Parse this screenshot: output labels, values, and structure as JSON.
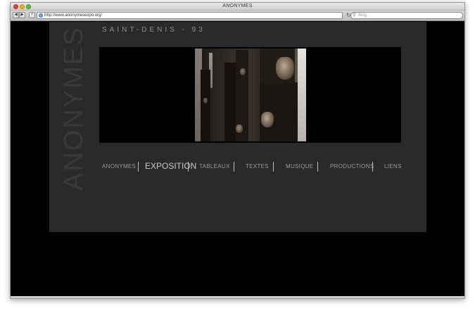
{
  "window": {
    "title": "ANONYMES"
  },
  "toolbar": {
    "url": "http://www.anonymesexpo.org/",
    "search_placeholder": "Bing",
    "back_glyph": "◀",
    "forward_glyph": "▶",
    "add_glyph": "+",
    "reload_glyph": "↻"
  },
  "site": {
    "vertical_title": "ANONYMES",
    "location": "SAINT-DENIS - 93",
    "menu": [
      {
        "label": "ANONYMES"
      },
      {
        "label": "EXPOSITION",
        "active": true
      },
      {
        "label": "TABLEAUX"
      },
      {
        "label": "TEXTES"
      },
      {
        "label": "MUSIQUE"
      },
      {
        "label": "PRODUCTIONS"
      },
      {
        "label": "LIENS"
      }
    ]
  },
  "icons": {
    "globe": "globe-icon",
    "search": "search-icon",
    "reload": "reload-icon"
  },
  "colors": {
    "page_bg": "#000000",
    "panel_bg": "#2a2a2a",
    "menu_text": "#9a9a9a",
    "menu_active": "#c8c8c8"
  }
}
